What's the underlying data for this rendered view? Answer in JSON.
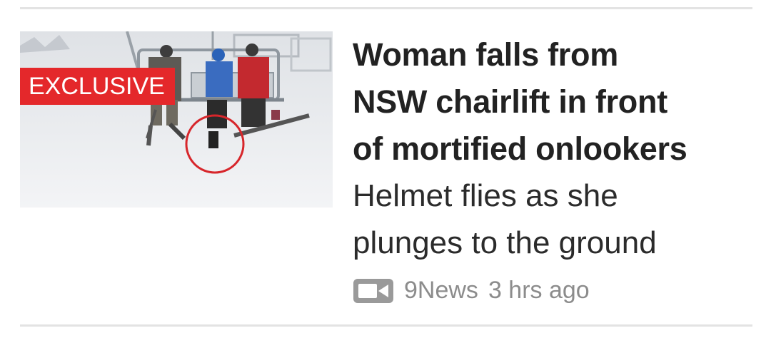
{
  "article": {
    "badge": "EXCLUSIVE",
    "headline": "Woman falls from\nNSW chairlift in front\nof mortified onlookers",
    "subheadline": "Helmet flies as she\nplunges to the ground",
    "source": "9News",
    "time_ago": "3 hrs ago",
    "media_icon": "video-camera-icon",
    "thumbnail_description_icon": "chairlift-photo"
  },
  "colors": {
    "badge_bg": "#e4282b",
    "headline": "#222222",
    "meta": "#8c8c8c",
    "divider": "#e3e3e3"
  }
}
